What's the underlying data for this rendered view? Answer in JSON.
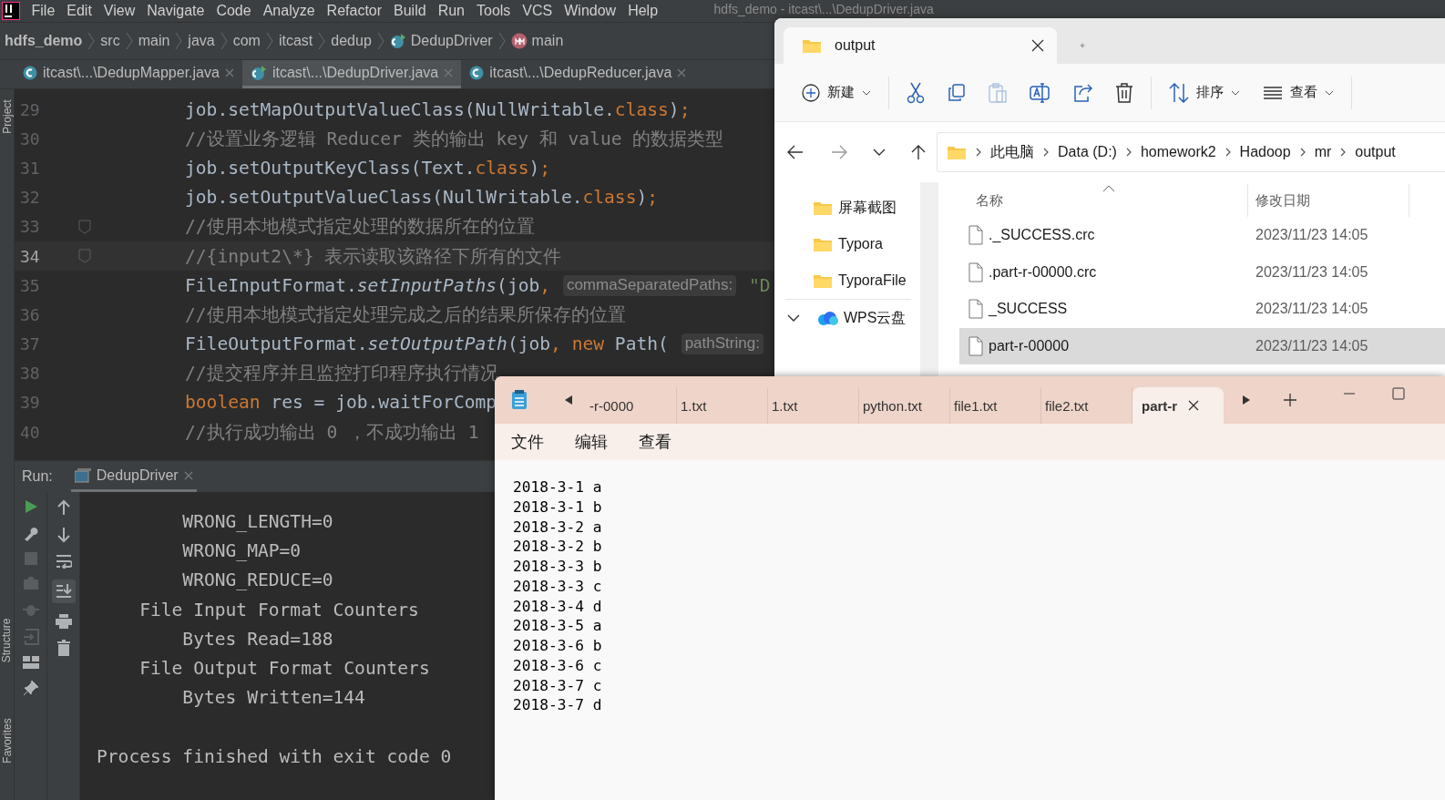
{
  "ide": {
    "menu": [
      "File",
      "Edit",
      "View",
      "Navigate",
      "Code",
      "Analyze",
      "Refactor",
      "Build",
      "Run",
      "Tools",
      "VCS",
      "Window",
      "Help"
    ],
    "title": "hdfs_demo - itcast\\...\\DedupDriver.java",
    "breadcrumb": [
      {
        "label": "hdfs_demo",
        "kind": "project"
      },
      {
        "label": "src",
        "kind": "folder"
      },
      {
        "label": "main",
        "kind": "folder"
      },
      {
        "label": "java",
        "kind": "folder"
      },
      {
        "label": "com",
        "kind": "folder"
      },
      {
        "label": "itcast",
        "kind": "folder"
      },
      {
        "label": "dedup",
        "kind": "folder"
      },
      {
        "label": "DedupDriver",
        "kind": "class"
      },
      {
        "label": "main",
        "kind": "method"
      }
    ],
    "side_labels": {
      "top": "Project",
      "bottom": [
        "Structure",
        "Favorites"
      ]
    },
    "editor_tabs": [
      {
        "label": "itcast\\...\\DedupMapper.java",
        "selected": false,
        "kind": "class"
      },
      {
        "label": "itcast\\...\\DedupDriver.java",
        "selected": true,
        "kind": "runnable"
      },
      {
        "label": "itcast\\...\\DedupReducer.java",
        "selected": false,
        "kind": "class"
      }
    ],
    "code_lines": [
      {
        "number": "29",
        "current": false,
        "fold_marker": false,
        "segments": [
          {
            "kind": "plain",
            "text": "job.setMapOutputValueClass(NullWritable."
          },
          {
            "kind": "keyword",
            "text": "class"
          },
          {
            "kind": "plain",
            "text": ")"
          },
          {
            "kind": "keyword",
            "text": ";"
          }
        ]
      },
      {
        "number": "30",
        "current": false,
        "fold_marker": false,
        "segments": [
          {
            "kind": "comment",
            "text": "//设置业务逻辑 Reducer 类的输出 key 和 value 的数据类型"
          }
        ]
      },
      {
        "number": "31",
        "current": false,
        "fold_marker": false,
        "segments": [
          {
            "kind": "plain",
            "text": "job.setOutputKeyClass(Text."
          },
          {
            "kind": "keyword",
            "text": "class"
          },
          {
            "kind": "plain",
            "text": ")"
          },
          {
            "kind": "keyword",
            "text": ";"
          }
        ]
      },
      {
        "number": "32",
        "current": false,
        "fold_marker": false,
        "segments": [
          {
            "kind": "plain",
            "text": "job.setOutputValueClass(NullWritable."
          },
          {
            "kind": "keyword",
            "text": "class"
          },
          {
            "kind": "plain",
            "text": ")"
          },
          {
            "kind": "keyword",
            "text": ";"
          }
        ]
      },
      {
        "number": "33",
        "current": false,
        "fold_marker": true,
        "segments": [
          {
            "kind": "comment",
            "text": "//使用本地模式指定处理的数据所在的位置"
          }
        ]
      },
      {
        "number": "34",
        "current": true,
        "fold_marker": true,
        "segments": [
          {
            "kind": "comment",
            "text": "//{input2\\*} 表示读取该路径下所有的文件"
          }
        ]
      },
      {
        "number": "35",
        "current": false,
        "fold_marker": false,
        "segments": [
          {
            "kind": "plain",
            "text": "FileInputFormat."
          },
          {
            "kind": "method",
            "text": "setInputPaths"
          },
          {
            "kind": "plain",
            "text": "(job"
          },
          {
            "kind": "keyword",
            "text": ", "
          },
          {
            "kind": "hint",
            "text": "commaSeparatedPaths:"
          },
          {
            "kind": "string",
            "text": " \"D"
          }
        ]
      },
      {
        "number": "36",
        "current": false,
        "fold_marker": false,
        "segments": [
          {
            "kind": "comment",
            "text": "//使用本地模式指定处理完成之后的结果所保存的位置"
          }
        ]
      },
      {
        "number": "37",
        "current": false,
        "fold_marker": false,
        "segments": [
          {
            "kind": "plain",
            "text": "FileOutputFormat."
          },
          {
            "kind": "method",
            "text": "setOutputPath"
          },
          {
            "kind": "plain",
            "text": "(job"
          },
          {
            "kind": "keyword",
            "text": ", new"
          },
          {
            "kind": "plain",
            "text": " Path( "
          },
          {
            "kind": "hint",
            "text": "pathString:"
          }
        ]
      },
      {
        "number": "38",
        "current": false,
        "fold_marker": false,
        "segments": [
          {
            "kind": "comment",
            "text": "//提交程序并且监控打印程序执行情况"
          }
        ]
      },
      {
        "number": "39",
        "current": false,
        "fold_marker": false,
        "segments": [
          {
            "kind": "keyword",
            "text": "boolean"
          },
          {
            "kind": "plain",
            "text": " res = job.waitForComp"
          }
        ]
      },
      {
        "number": "40",
        "current": false,
        "fold_marker": false,
        "segments": [
          {
            "kind": "comment",
            "text": "//执行成功输出 0 ，不成功输出 1"
          }
        ]
      }
    ],
    "run": {
      "label": "Run:",
      "tab": "DedupDriver",
      "console": [
        "        WRONG_LENGTH=0",
        "        WRONG_MAP=0",
        "        WRONG_REDUCE=0",
        "    File Input Format Counters",
        "        Bytes Read=188",
        "    File Output Format Counters",
        "        Bytes Written=144"
      ],
      "exit_message": "Process finished with exit code 0"
    }
  },
  "explorer": {
    "tabs": [
      {
        "label": "output",
        "selected": true
      }
    ],
    "toolbar": [
      {
        "kind": "new",
        "label": "新建",
        "disabled": false
      },
      {
        "kind": "cut",
        "disabled": false
      },
      {
        "kind": "copy",
        "disabled": false
      },
      {
        "kind": "paste",
        "disabled": true
      },
      {
        "kind": "rename",
        "disabled": false
      },
      {
        "kind": "share",
        "disabled": false
      },
      {
        "kind": "delete",
        "disabled": false
      },
      {
        "kind": "sort",
        "label": "排序",
        "disabled": false
      },
      {
        "kind": "view",
        "label": "查看",
        "disabled": false
      }
    ],
    "address": [
      "此电脑",
      "Data (D:)",
      "homework2",
      "Hadoop",
      "mr",
      "output"
    ],
    "nav": [
      {
        "label": "屏幕截图",
        "kind": "folder"
      },
      {
        "label": "Typora",
        "kind": "folder"
      },
      {
        "label": "TyporaFile",
        "kind": "folder"
      },
      {
        "label": "WPS云盘",
        "kind": "cloud",
        "expanded": true
      }
    ],
    "columns": [
      {
        "label": "名称",
        "sorted": true
      },
      {
        "label": "修改日期",
        "sorted": false
      }
    ],
    "rows": [
      {
        "name": "._SUCCESS.crc",
        "modified": "2023/11/23 14:05",
        "selected": false
      },
      {
        "name": ".part-r-00000.crc",
        "modified": "2023/11/23 14:05",
        "selected": false
      },
      {
        "name": "_SUCCESS",
        "modified": "2023/11/23 14:05",
        "selected": false
      },
      {
        "name": "part-r-00000",
        "modified": "2023/11/23 14:05",
        "selected": true
      }
    ]
  },
  "notepad": {
    "tabs": [
      {
        "label": "-r-0000",
        "selected": false
      },
      {
        "label": "1.txt",
        "selected": false
      },
      {
        "label": "1.txt",
        "selected": false
      },
      {
        "label": "python.txt",
        "selected": false
      },
      {
        "label": "file1.txt",
        "selected": false
      },
      {
        "label": "file2.txt",
        "selected": false
      },
      {
        "label": "part-r",
        "selected": true
      }
    ],
    "menu": [
      "文件",
      "编辑",
      "查看"
    ],
    "lines": [
      "2018-3-1 a",
      "2018-3-1 b",
      "2018-3-2 a",
      "2018-3-2 b",
      "2018-3-3 b",
      "2018-3-3 c",
      "2018-3-4 d",
      "2018-3-5 a",
      "2018-3-6 b",
      "2018-3-6 c",
      "2018-3-7 c",
      "2018-3-7 d"
    ]
  }
}
